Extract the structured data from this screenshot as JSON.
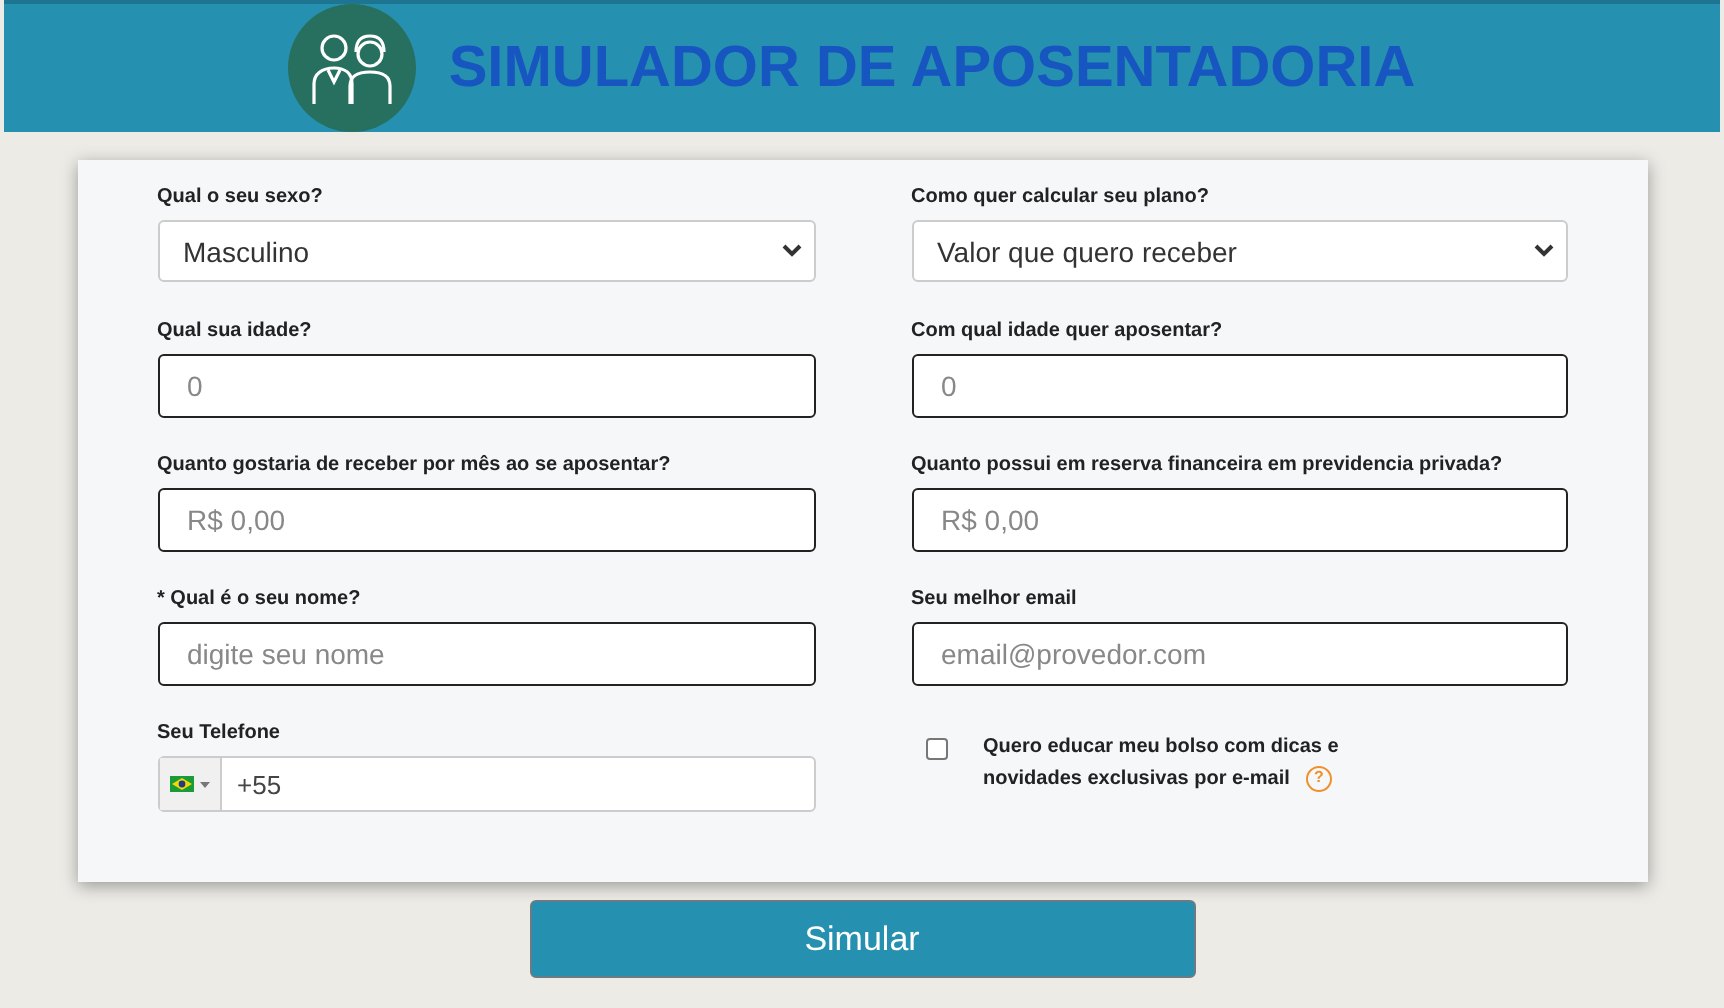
{
  "header": {
    "title": "SIMULADOR DE APOSENTADORIA"
  },
  "fields": [
    {
      "kind": "select",
      "label": "Qual o seu sexo?",
      "value": "Masculino"
    },
    {
      "kind": "select",
      "label": "Como quer calcular seu plano?",
      "value": "Valor que quero receber"
    },
    {
      "kind": "input",
      "label": "Qual sua idade?",
      "placeholder": "0"
    },
    {
      "kind": "input",
      "label": "Com qual idade quer aposentar?",
      "placeholder": "0"
    },
    {
      "kind": "input",
      "label": "Quanto gostaria de receber por mês ao se aposentar?",
      "placeholder": "R$ 0,00"
    },
    {
      "kind": "input",
      "label": "Quanto possui em reserva financeira em previdencia privada?",
      "placeholder": "R$ 0,00"
    },
    {
      "kind": "input",
      "label": "* Qual é o seu nome?",
      "placeholder": "digite seu nome"
    },
    {
      "kind": "input",
      "label": "Seu melhor email",
      "placeholder": "email@provedor.com"
    },
    {
      "kind": "phone",
      "label": "Seu Telefone",
      "value": "+55"
    },
    {
      "kind": "checkbox",
      "label": "Quero educar meu bolso com dicas e novidades exclusivas por e-mail",
      "checked": false,
      "help": "?"
    }
  ],
  "submit": {
    "label": "Simular"
  }
}
